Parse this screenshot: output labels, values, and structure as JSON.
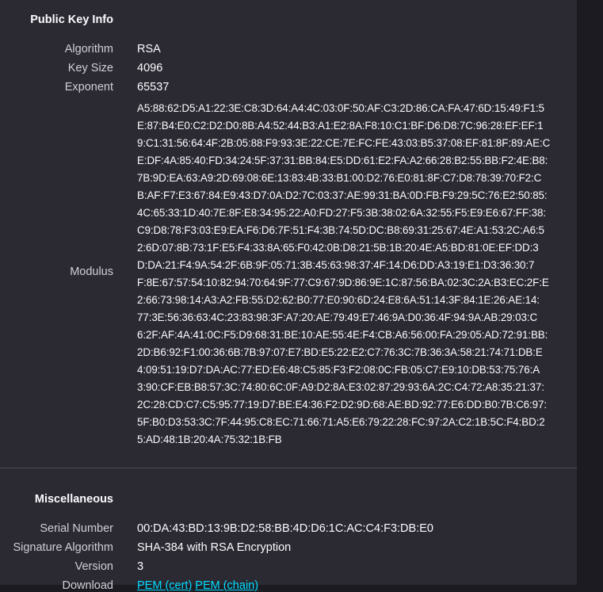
{
  "public_key": {
    "title": "Public Key Info",
    "algorithm_label": "Algorithm",
    "algorithm_value": "RSA",
    "key_size_label": "Key Size",
    "key_size_value": "4096",
    "exponent_label": "Exponent",
    "exponent_value": "65537",
    "modulus_label": "Modulus",
    "modulus_lines": [
      "A5:88:62:D5:A1:22:3E:C8:3D:64:A4:4C:03:0F:50:AF:C3:2D:86:CA:FA:47:6D:15:49:F1:5",
      "E:87:B4:E0:C2:D2:D0:8B:A4:52:44:B3:A1:E2:8A:F8:10:C1:BF:D6:D8:7C:96:28:EF:EF:1",
      "9:C1:31:56:64:4F:2B:05:88:F9:93:3E:22:CE:7E:FC:FE:43:03:B5:37:08:EF:81:8F:89:AE:C",
      "E:DF:4A:85:40:FD:34:24:5F:37:31:BB:84:E5:DD:61:E2:FA:A2:66:28:B2:55:BB:F2:4E:B8:",
      "7B:9D:EA:63:A9:2D:69:08:6E:13:83:4B:33:B1:00:D2:76:E0:81:8F:C7:D8:78:39:70:F2:C",
      "B:AF:F7:E3:67:84:E9:43:D7:0A:D2:7C:03:37:AE:99:31:BA:0D:FB:F9:29:5C:76:E2:50:85:",
      "4C:65:33:1D:40:7E:8F:E8:34:95:22:A0:FD:27:F5:3B:38:02:6A:32:55:F5:E9:E6:67:FF:38:",
      "C9:D8:78:F3:03:E9:EA:F6:D6:7F:51:F4:3B:74:5D:DC:B8:69:31:25:67:4E:A1:53:2C:A6:5",
      "2:6D:07:8B:73:1F:E5:F4:33:8A:65:F0:42:0B:D8:21:5B:1B:20:4E:A5:BD:81:0E:EF:DD:3",
      "D:DA:21:F4:9A:54:2F:6B:9F:05:71:3B:45:63:98:37:4F:14:D6:DD:A3:19:E1:D3:36:30:7",
      "F:8E:67:57:54:10:82:94:70:64:9F:77:C9:67:9D:86:9E:1C:87:56:BA:02:3C:2A:B3:EC:2F:E",
      "2:66:73:98:14:A3:A2:FB:55:D2:62:B0:77:E0:90:6D:24:E8:6A:51:14:3F:84:1E:26:AE:14:",
      "77:3E:56:36:63:4C:23:83:98:3F:A7:20:AE:79:49:E7:46:9A:D0:36:4F:94:9A:AB:29:03:C",
      "6:2F:AF:4A:41:0C:F5:D9:68:31:BE:10:AE:55:4E:F4:CB:A6:56:00:FA:29:05:AD:72:91:BB:",
      "2D:B6:92:F1:00:36:6B:7B:97:07:E7:BD:E5:22:E2:C7:76:3C:7B:36:3A:58:21:74:71:DB:E",
      "4:09:51:19:D7:DA:AC:77:ED:E6:48:C5:85:F3:F2:08:0C:FB:05:C7:E9:10:DB:53:75:76:A",
      "3:90:CF:EB:B8:57:3C:74:80:6C:0F:A9:D2:8A:E3:02:87:29:93:6A:2C:C4:72:A8:35:21:37:",
      "2C:28:CD:C7:C5:95:77:19:D7:BE:E4:36:F2:D2:9D:68:AE:BD:92:77:E6:DD:B0:7B:C6:97:",
      "5F:B0:D3:53:3C:7F:44:95:C8:EC:71:66:71:A5:E6:79:22:28:FC:97:2A:C2:1B:5C:F4:BD:2",
      "5:AD:48:1B:20:4A:75:32:1B:FB"
    ]
  },
  "misc": {
    "title": "Miscellaneous",
    "serial_label": "Serial Number",
    "serial_value": "00:DA:43:BD:13:9B:D2:58:BB:4D:D6:1C:AC:C4:F3:DB:E0",
    "sigalg_label": "Signature Algorithm",
    "sigalg_value": "SHA-384 with RSA Encryption",
    "version_label": "Version",
    "version_value": "3",
    "download_label": "Download",
    "download_pem_cert": "PEM (cert)",
    "download_pem_chain": "PEM (chain)"
  },
  "colors": {
    "background": "#2b2a33",
    "link": "#00ddff"
  }
}
